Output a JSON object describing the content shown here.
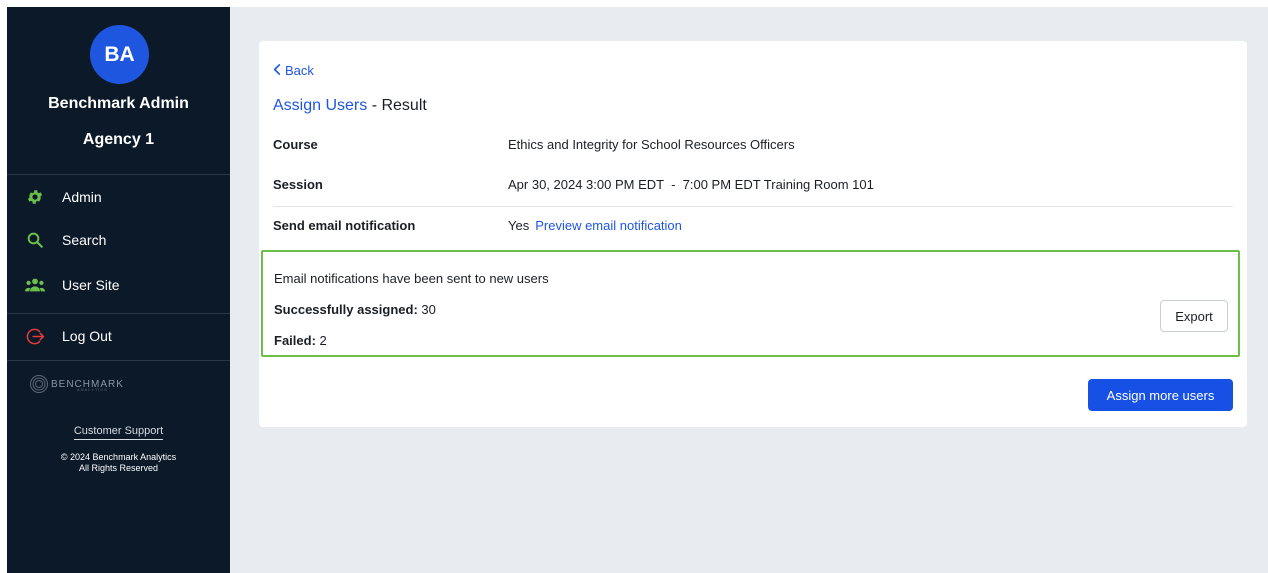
{
  "sidebar": {
    "avatar_initials": "BA",
    "user_name": "Benchmark Admin",
    "agency": "Agency 1",
    "nav": {
      "admin": "Admin",
      "search": "Search",
      "user_site": "User Site",
      "logout": "Log Out"
    },
    "logo_text": "BENCHMARK",
    "logo_subtext": "ANALYTICS",
    "support_label": "Customer Support",
    "copyright_line1": "© 2024 Benchmark Analytics",
    "copyright_line2": "All Rights Reserved",
    "icons": {
      "admin": "gear-icon",
      "search": "search-icon",
      "user_site": "users-icon",
      "logout": "logout-icon"
    }
  },
  "main": {
    "back_label": "Back",
    "breadcrumb_link": "Assign Users",
    "title_suffix": " - Result",
    "details": {
      "course_label": "Course",
      "course_value": "Ethics and Integrity for School Resources Officers",
      "session_label": "Session",
      "session_value": "Apr 30, 2024 3:00 PM EDT  -  7:00 PM EDT Training Room 101",
      "email_label": "Send email notification",
      "email_value": "Yes",
      "email_preview_link": "Preview email notification"
    },
    "result": {
      "message": "Email notifications have been sent to new users",
      "success_label": "Successfully assigned:",
      "success_count": "30",
      "failed_label": "Failed:",
      "failed_count": "2",
      "export_label": "Export"
    },
    "assign_more_label": "Assign more users"
  },
  "colors": {
    "sidebar_bg": "#0b1929",
    "accent_blue": "#1f56e0",
    "icon_green": "#6cc04a",
    "logout_red": "#e23b3b",
    "result_border": "#6cc04a",
    "page_bg": "#e8ebef"
  }
}
